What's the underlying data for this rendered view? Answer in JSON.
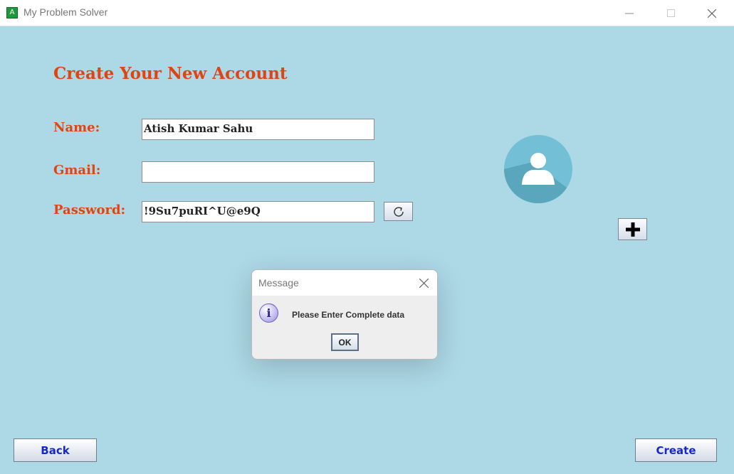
{
  "window": {
    "title": "My Problem Solver",
    "icon_letter": "A",
    "controls": [
      "minimize-icon",
      "maximize-icon",
      "close-icon"
    ]
  },
  "form": {
    "heading": "Create Your New Account",
    "name_label": "Name:",
    "name_value": "Atish Kumar Sahu",
    "gmail_label": "Gmail:",
    "gmail_value": "",
    "password_label": "Password:",
    "password_value": "!9Su7puRI^U@e9Q",
    "refresh_icon": "refresh-icon",
    "avatar_icon": "user-avatar-icon",
    "add_photo_icon": "plus-icon"
  },
  "dialog": {
    "title": "Message",
    "icon": "info-icon",
    "icon_glyph": "i",
    "message": "Please Enter Complete data",
    "ok_label": "OK"
  },
  "buttons": {
    "back": "Back",
    "create": "Create"
  },
  "colors": {
    "background": "#add8e6",
    "accent_text": "#e04412",
    "button_text": "#1728c9",
    "avatar_circle": "#72bfd6"
  }
}
